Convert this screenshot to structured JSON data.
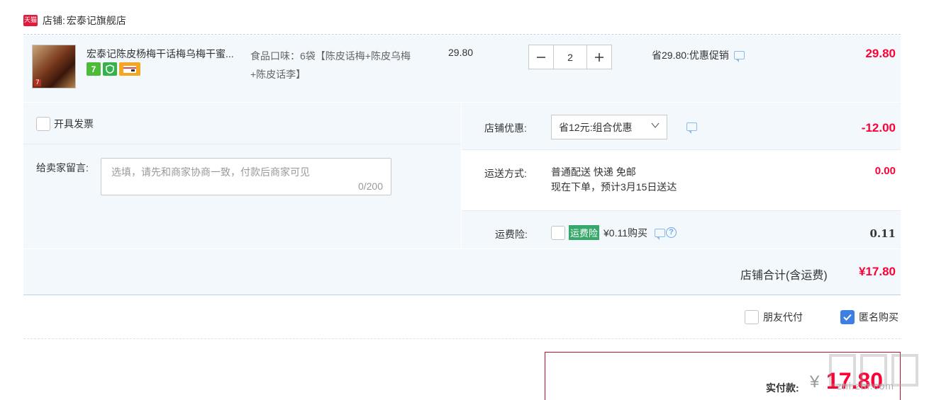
{
  "shop": {
    "label": "店铺:",
    "name": "宏泰记旗舰店",
    "badge": "天猫"
  },
  "item": {
    "thumb_label": "7",
    "title": "宏泰记陈皮杨梅干话梅乌梅干蜜...",
    "spec": "食品口味：6袋【陈皮话梅+陈皮乌梅+陈皮话李】",
    "unit_price": "29.80",
    "quantity": "2",
    "promo": "省29.80:优惠促销",
    "total": "29.80",
    "badges": [
      "7",
      "shield-icon",
      "card-icon"
    ]
  },
  "options": {
    "invoice_label": "开具发票",
    "message_label": "给卖家留言:",
    "message_placeholder": "选填，请先和商家协商一致，付款后商家可见",
    "message_count": "0/200",
    "shop_discount_label": "店铺优惠:",
    "shop_discount_option": "省12元:组合优惠",
    "shop_discount_value": "-12.00",
    "shipping_label": "运送方式:",
    "shipping_method": "普通配送 快递 免邮",
    "shipping_eta": "现在下单，预计3月15日送达",
    "shipping_value": "0.00",
    "insurance_label": "运费险:",
    "insurance_badge": "运费险",
    "insurance_price": "¥0.11购买",
    "insurance_value": "0.11"
  },
  "summary": {
    "shop_total_label": "店铺合计(含运费)",
    "shop_total_value": "¥17.80",
    "friend_pay_label": "朋友代付",
    "anonymous_label": "匿名购买",
    "anonymous_checked": true,
    "pay_label": "实付款:",
    "pay_currency": "¥",
    "pay_value": "17.80"
  },
  "watermark": {
    "text": "zhi.zhi.com"
  },
  "colors": {
    "price_red": "#ff0036",
    "panel_bg": "#f3f8fd",
    "accent_blue": "#3d7fe3",
    "insurance_green": "#36a86a"
  }
}
